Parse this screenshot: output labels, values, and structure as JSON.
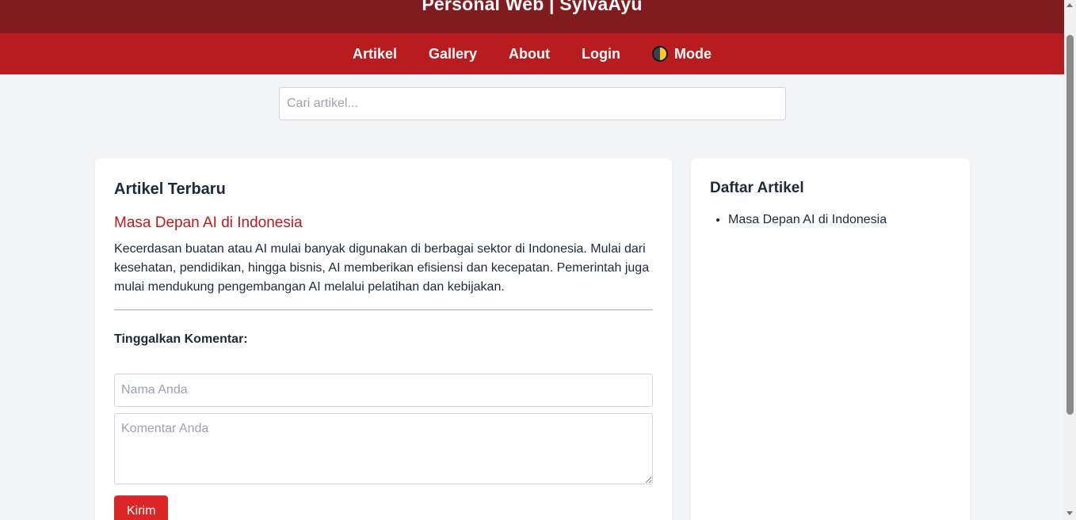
{
  "header": {
    "title": "Personal Web | SylvaAyu"
  },
  "nav": {
    "items": [
      {
        "label": "Artikel"
      },
      {
        "label": "Gallery"
      },
      {
        "label": "About"
      },
      {
        "label": "Login"
      }
    ],
    "mode": {
      "label": "Mode",
      "icon": "half-moon-toggle-icon"
    }
  },
  "search": {
    "placeholder": "Cari artikel...",
    "value": ""
  },
  "main": {
    "heading": "Artikel Terbaru",
    "article": {
      "title": "Masa Depan AI di Indonesia",
      "body": "Kecerdasan buatan atau AI mulai banyak digunakan di berbagai sektor di Indonesia. Mulai dari kesehatan, pendidikan, hingga bisnis, AI memberikan efisiensi dan kecepatan. Pemerintah juga mulai mendukung pengembangan AI melalui pelatihan dan kebijakan."
    },
    "comment": {
      "label": "Tinggalkan Komentar:",
      "name_placeholder": "Nama Anda",
      "comment_placeholder": "Komentar Anda",
      "submit_label": "Kirim"
    }
  },
  "sidebar": {
    "heading": "Daftar Artikel",
    "items": [
      "Masa Depan AI di Indonesia"
    ]
  },
  "colors": {
    "header_bg": "#821b1e",
    "nav_bg": "#b91c1f",
    "accent": "#b91c1f",
    "button": "#dc2626",
    "page_bg": "#f3f4f6"
  }
}
